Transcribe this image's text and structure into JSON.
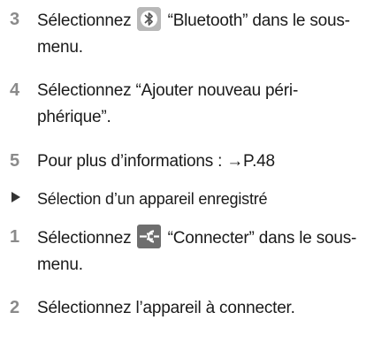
{
  "document": {
    "steps_top": [
      {
        "number": "3",
        "text_before": "Sélectionnez ",
        "icon": "bluetooth-icon",
        "text_after": " “Bluetooth” dans le sous-menu."
      },
      {
        "number": "4",
        "text": "Sélectionnez “Ajouter nouveau péri-phérique”."
      },
      {
        "number": "5",
        "text": "Pour plus d’informations : →P.48"
      }
    ],
    "section_marker": "triangle-bullet-icon",
    "section_title": "Sélection d’un appareil enregistré",
    "steps_bottom": [
      {
        "number": "1",
        "text_before": "Sélectionnez ",
        "icon": "connect-plug-icon",
        "text_after": " “Connecter” dans le sous-menu."
      },
      {
        "number": "2",
        "text": "Sélectionnez l’appareil à connecter."
      }
    ]
  },
  "colors": {
    "step_number": "#8a8a8a",
    "body_text": "#1a1a1a",
    "bluetooth_button": "#b8b8b8",
    "connect_button": "#6e6e6e"
  }
}
